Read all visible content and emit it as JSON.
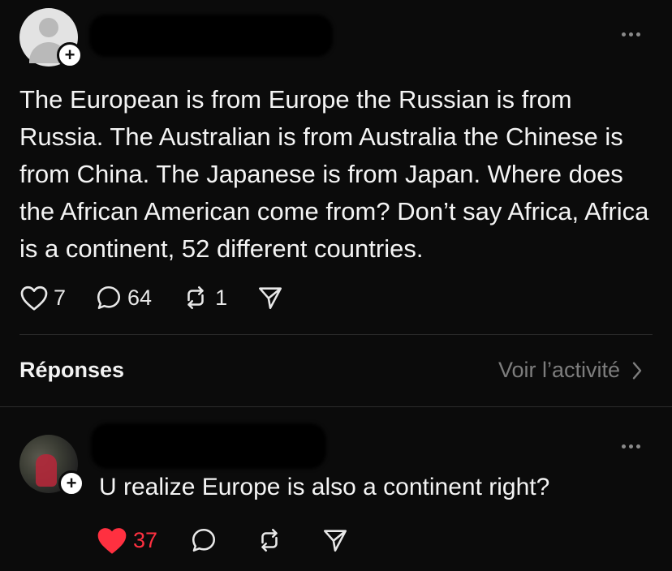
{
  "post": {
    "avatar_icon": "person-placeholder-icon",
    "text": "The European is from Europe the Russian  is from Russia. The Australian is from Australia the Chinese is from China. The Japanese is from Japan. Where does the African American come from? Don’t say Africa, Africa is a continent, 52 different countries.",
    "likes": "7",
    "comments": "64",
    "reposts": "1",
    "liked": false
  },
  "replies_section": {
    "label": "Réponses",
    "activity_link": "Voir l’activité"
  },
  "reply": {
    "text": "U realize Europe is also a continent right?",
    "likes": "37",
    "liked": true,
    "like_color": "#ff3040"
  },
  "colors": {
    "background": "#0b0b0b",
    "text": "#f3f3f3",
    "muted": "#7d7d7d",
    "divider": "#2b2b2b"
  }
}
